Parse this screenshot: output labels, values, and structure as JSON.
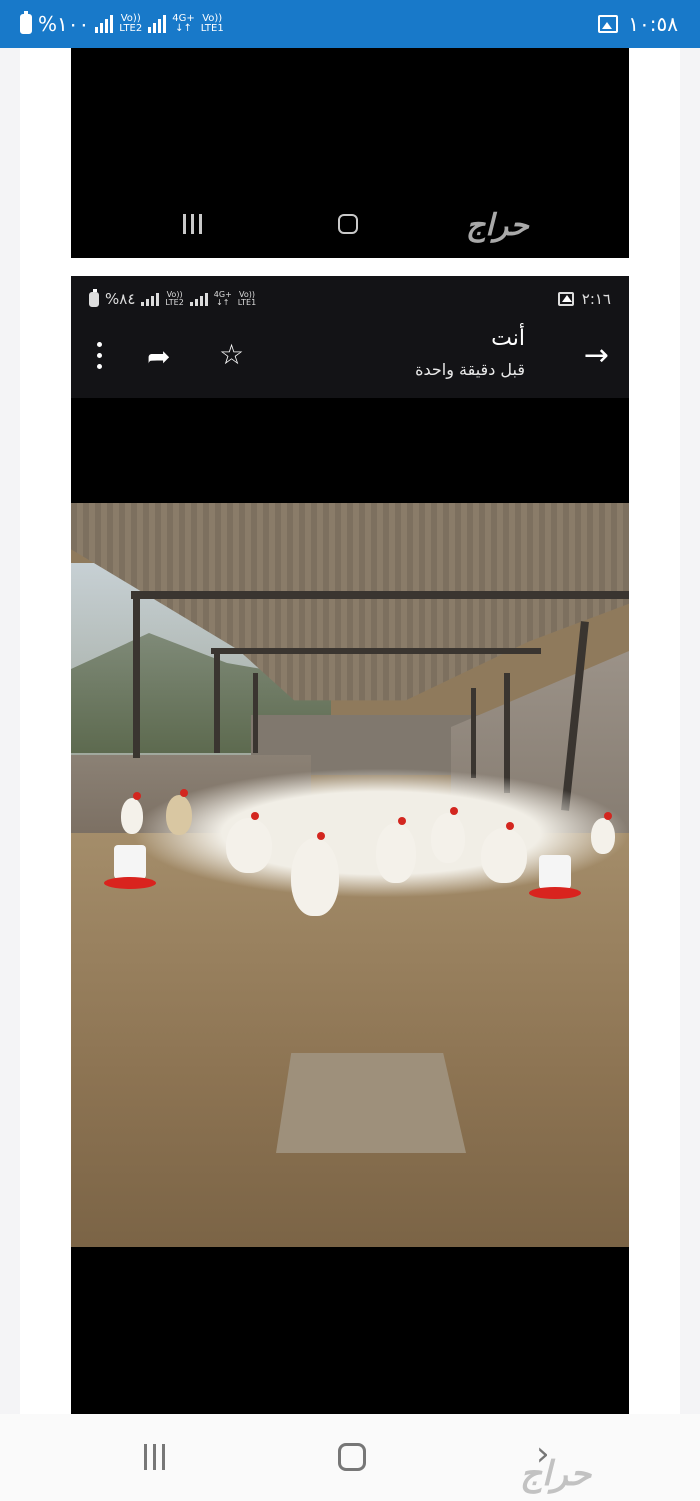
{
  "status_bar": {
    "battery_text": "%١٠٠",
    "sim1": "LTE2",
    "sim1_top": "Vo))",
    "sim2_top": "4G+",
    "sim2_bottom": "↓↑",
    "sim3_top": "Vo))",
    "sim3_bottom": "LTE1",
    "time": "١٠:٥٨",
    "bg_color": "#1879c9"
  },
  "top_block": {
    "watermark": "حراج"
  },
  "inner_screenshot": {
    "status": {
      "battery_text": "%٨٤",
      "sim1_top": "Vo))",
      "sim1_bottom": "LTE2",
      "sim2_top": "4G+",
      "sim2_bottom": "↓↑",
      "sim3_top": "Vo))",
      "sim3_bottom": "LTE1",
      "time": "٢:١٦"
    },
    "toolbar": {
      "title": "أنت",
      "subtitle": "قبل دقيقة واحدة"
    }
  },
  "bottom_nav": {
    "watermark": "حراج"
  }
}
